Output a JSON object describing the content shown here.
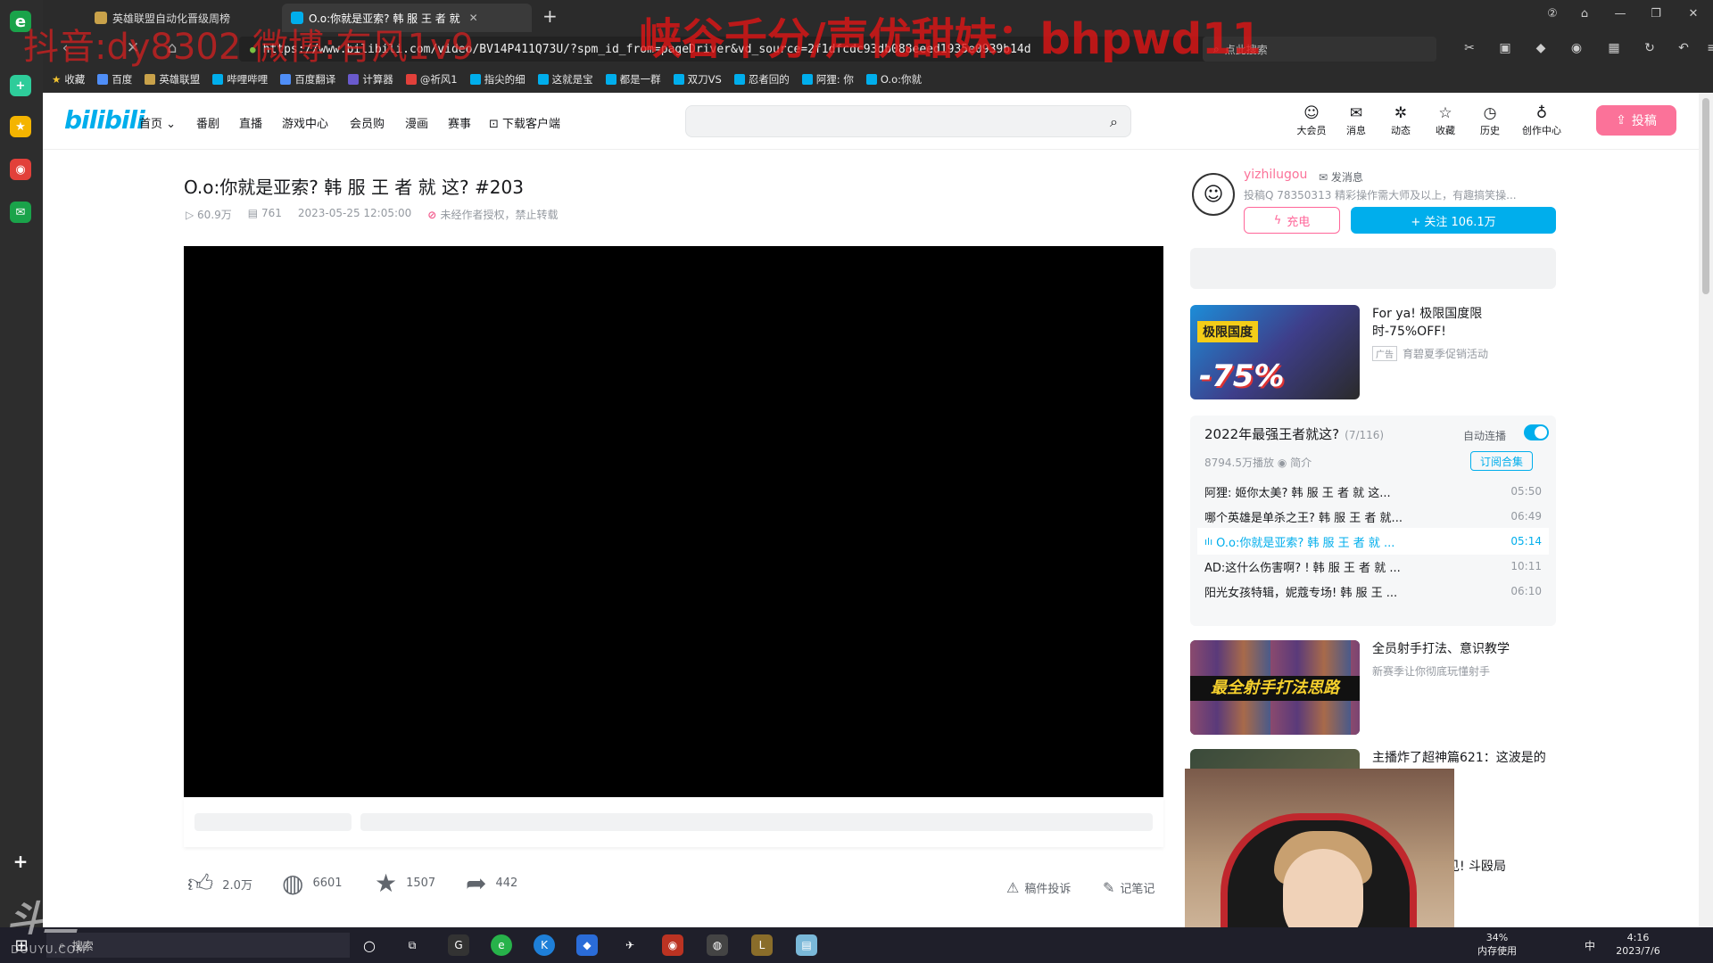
{
  "overlay": {
    "watermark_left": "抖音:dy8302 微博:有风1v9",
    "watermark_right": "峡谷千分/声优甜妹：bhpwd11",
    "brand_bottom": "斗鱼",
    "brand_bottom_sub": "DOUYU.COM"
  },
  "browser": {
    "tabs": [
      {
        "label": "英雄联盟自动化晋级周榜"
      },
      {
        "label": "O.o:你就是亚索? 韩 服 王 者 就"
      }
    ],
    "url": "https://www.bilibili.com/video/BV14P411Q73U/?spm_id_from=pageDriver&vd_source=2f1dfcdc93db088eeed1935e0939b14d",
    "search_placeholder": "点此搜索",
    "bookmarks": [
      "收藏",
      "百度",
      "英雄联盟",
      "哔哩哔哩",
      "百度翻译",
      "计算器",
      "@祈风1",
      "指尖的细",
      "这就是宝",
      "都是一群",
      "双刀VS",
      "忍者回的",
      "阿狸: 你",
      "O.o:你就"
    ]
  },
  "site": {
    "logo": "bilibili",
    "nav": [
      "首页",
      "番剧",
      "直播",
      "游戏中心",
      "会员购",
      "漫画",
      "赛事",
      "下载客户端"
    ],
    "header_items": [
      {
        "label": "大会员",
        "icon": "vip-icon"
      },
      {
        "label": "消息",
        "icon": "message-icon"
      },
      {
        "label": "动态",
        "icon": "dynamic-icon"
      },
      {
        "label": "收藏",
        "icon": "favorite-icon"
      },
      {
        "label": "历史",
        "icon": "history-icon"
      },
      {
        "label": "创作中心",
        "icon": "creator-icon"
      }
    ],
    "upload_label": "投稿"
  },
  "video": {
    "title": "O.o:你就是亚索? 韩 服 王 者 就 这? #203",
    "views": "60.9万",
    "danmaku": "761",
    "date": "2023-05-25 12:05:00",
    "warning": "未经作者授权，禁止转载",
    "likes": "2.0万",
    "coins": "6601",
    "favorites": "1507",
    "shares": "442",
    "report_label": "稿件投诉",
    "notes_label": "记笔记"
  },
  "uploader": {
    "name": "yizhilugou",
    "msg_label": "发消息",
    "desc": "投稿Q 78350313 精彩操作需大师及以上，有趣搞笑操...",
    "charge_label": "充电",
    "follow_label": "+ 关注 106.1万"
  },
  "ad": {
    "title": "For ya! 极限国度限时-75%OFF!",
    "tag": "广告",
    "source": "育碧夏季促销活动",
    "thumb_badge": "极限国度",
    "thumb_discount": "-75%"
  },
  "playlist": {
    "title": "2022年最强王者就这?",
    "progress": "(7/116)",
    "autoplay_label": "自动连播",
    "stats": "8794.5万播放",
    "intro_label": "简介",
    "subscribe_label": "订阅合集",
    "items": [
      {
        "title": "阿狸: 姬你太美? 韩 服 王 者 就 这...",
        "duration": "05:50"
      },
      {
        "title": "哪个英雄是单杀之王? 韩 服 王 者 就...",
        "duration": "06:49"
      },
      {
        "title": "O.o:你就是亚索? 韩 服 王 者 就 ...",
        "duration": "05:14"
      },
      {
        "title": "AD:这什么伤害啊? ! 韩 服 王 者 就 ...",
        "duration": "10:11"
      },
      {
        "title": "阳光女孩特辑，妮蔻专场! 韩 服 王 ...",
        "duration": "06:10"
      }
    ]
  },
  "recommendations": [
    {
      "title": "全员射手打法、意识教学",
      "sub": "新赛季让你彻底玩懂射手",
      "banner": "最全射手打法思路"
    },
    {
      "title": "主播炸了超神篇621：这波是的梦想操作",
      "sub": ""
    },
    {
      "title": "几个月难得一见! 斗殴局#522...",
      "sub": ""
    }
  ],
  "taskbar": {
    "search_label": "搜索",
    "memory_pct": "34%",
    "memory_label": "内存使用",
    "ime": "中",
    "time": "4:16",
    "date": "2023/7/6"
  }
}
